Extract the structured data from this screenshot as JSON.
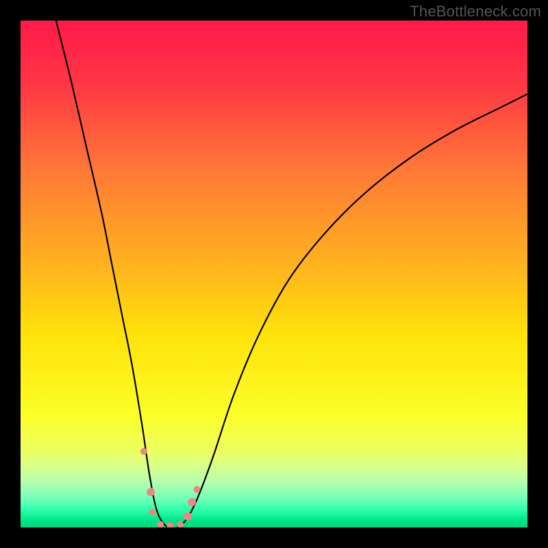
{
  "watermark": "TheBottleneck.com",
  "chart_data": {
    "type": "line",
    "title": "",
    "xlabel": "",
    "ylabel": "",
    "xlim": [
      0,
      100
    ],
    "ylim": [
      0,
      100
    ],
    "background_gradient": {
      "stops": [
        {
          "offset": 0.0,
          "color": "#ff1a4a"
        },
        {
          "offset": 0.12,
          "color": "#ff3545"
        },
        {
          "offset": 0.3,
          "color": "#ff7a36"
        },
        {
          "offset": 0.48,
          "color": "#ffb21e"
        },
        {
          "offset": 0.62,
          "color": "#ffe20a"
        },
        {
          "offset": 0.78,
          "color": "#fcff28"
        },
        {
          "offset": 0.85,
          "color": "#ecff62"
        },
        {
          "offset": 0.88,
          "color": "#d6ff8c"
        },
        {
          "offset": 0.91,
          "color": "#b4ffae"
        },
        {
          "offset": 0.94,
          "color": "#7affb8"
        },
        {
          "offset": 0.965,
          "color": "#30ffad"
        },
        {
          "offset": 0.985,
          "color": "#00e88c"
        },
        {
          "offset": 1.0,
          "color": "#00d67d"
        }
      ]
    },
    "series": [
      {
        "name": "bottleneck-curve",
        "color": "#000000",
        "x": [
          7,
          10,
          13,
          16,
          18,
          20,
          22,
          24,
          25.5,
          27,
          29,
          31,
          33,
          35,
          38,
          42,
          47,
          53,
          60,
          68,
          77,
          86,
          95,
          100
        ],
        "y": [
          100,
          88,
          75,
          62,
          52,
          42,
          32,
          20,
          10,
          3,
          0,
          0,
          2,
          6,
          14,
          26,
          38,
          49,
          58,
          66,
          73,
          78.5,
          83,
          85.5
        ]
      }
    ],
    "markers": {
      "name": "highlighted-points",
      "color": "#e88a82",
      "points": [
        {
          "x": 24.3,
          "y": 15,
          "r": 5
        },
        {
          "x": 25.7,
          "y": 7,
          "r": 6
        },
        {
          "x": 26.0,
          "y": 3,
          "r": 5
        },
        {
          "x": 27.6,
          "y": 0.6,
          "r": 5
        },
        {
          "x": 29.5,
          "y": 0.4,
          "r": 5
        },
        {
          "x": 31.5,
          "y": 0.6,
          "r": 5
        },
        {
          "x": 33.0,
          "y": 2.2,
          "r": 6
        },
        {
          "x": 33.8,
          "y": 5.0,
          "r": 6
        },
        {
          "x": 34.8,
          "y": 7.5,
          "r": 5
        }
      ]
    }
  }
}
